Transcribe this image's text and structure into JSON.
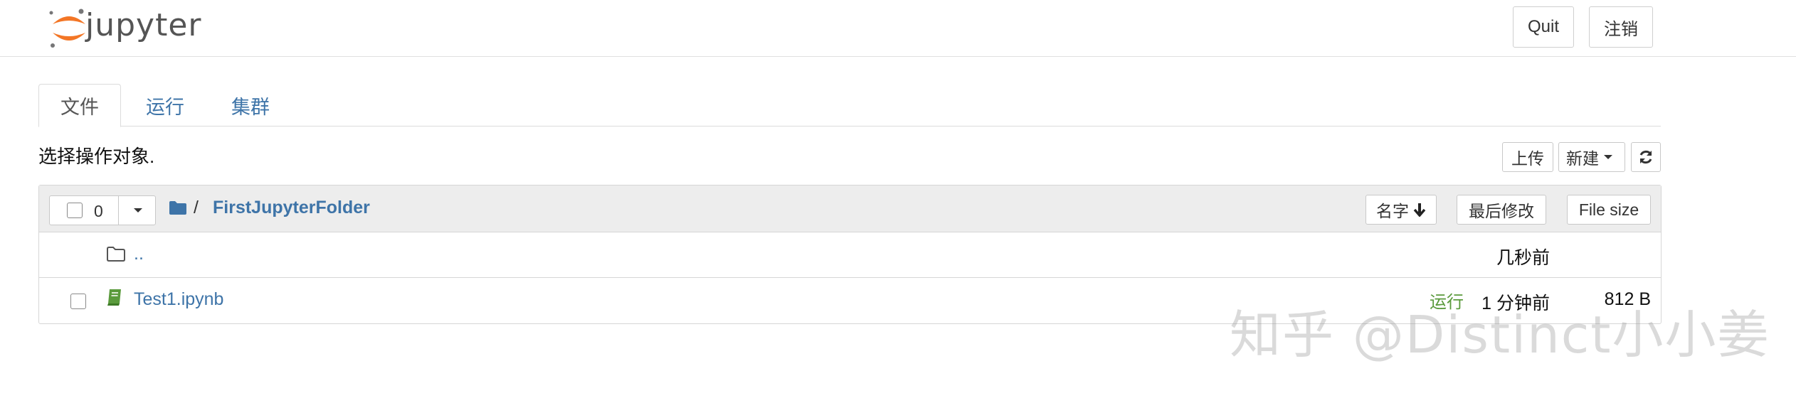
{
  "app": {
    "logo_text": "jupyter"
  },
  "header": {
    "quit_label": "Quit",
    "logout_label": "注销"
  },
  "tabs": [
    {
      "label": "文件",
      "active": true
    },
    {
      "label": "运行",
      "active": false
    },
    {
      "label": "集群",
      "active": false
    }
  ],
  "toolbar": {
    "select_text": "选择操作对象.",
    "upload_label": "上传",
    "new_label": "新建",
    "refresh_icon": "refresh-icon"
  },
  "list": {
    "selected_count": "0",
    "breadcrumb_sep": "/",
    "folder_name": "FirstJupyterFolder",
    "sort_name_label": "名字",
    "sort_modified_label": "最后修改",
    "sort_size_label": "File size"
  },
  "rows": [
    {
      "name": "..",
      "modified": "几秒前",
      "size": "",
      "running": "",
      "icon": "folder-icon"
    },
    {
      "name": "Test1.ipynb",
      "modified": "1 分钟前",
      "size": "812 B",
      "running": "运行",
      "icon": "notebook-icon"
    }
  ],
  "watermark": "知乎 @Distinct小小姜",
  "colors": {
    "link": "#3e74a8",
    "running": "#5a9a3c",
    "header_bg": "#ededed",
    "logo_orange": "#f37626"
  }
}
